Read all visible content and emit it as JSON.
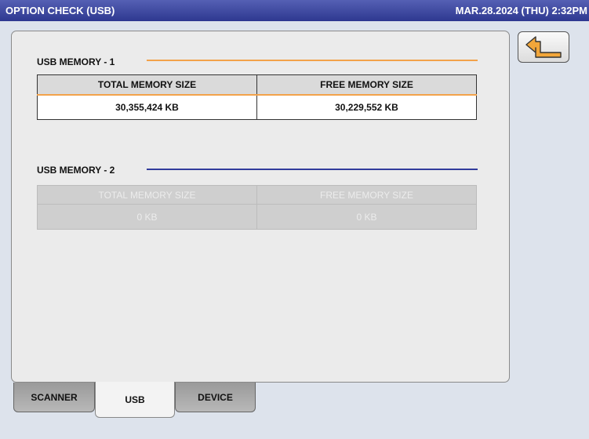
{
  "header": {
    "title": "OPTION CHECK (USB)",
    "datetime": "MAR.28.2024 (THU)  2:32PM"
  },
  "back_button": {
    "icon": "return-arrow-icon",
    "accent_color": "#f2a63a"
  },
  "usb1": {
    "label": "USB MEMORY - 1",
    "line_color": "#f2a24a",
    "total_header": "TOTAL MEMORY SIZE",
    "free_header": "FREE MEMORY SIZE",
    "total_value": "30,355,424 KB",
    "free_value": "30,229,552 KB"
  },
  "usb2": {
    "label": "USB MEMORY - 2",
    "line_color": "#323c9c",
    "total_header": "TOTAL MEMORY SIZE",
    "free_header": "FREE MEMORY SIZE",
    "total_value": "0 KB",
    "free_value": "0 KB"
  },
  "tabs": [
    {
      "label": "SCANNER",
      "active": false
    },
    {
      "label": "USB",
      "active": true
    },
    {
      "label": "DEVICE",
      "active": false
    }
  ]
}
